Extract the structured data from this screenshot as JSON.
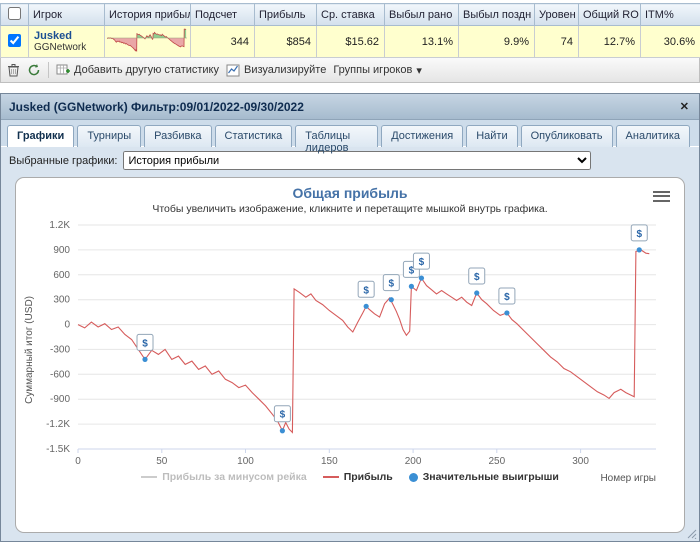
{
  "table": {
    "headers": [
      "Игрок",
      "История прибыли",
      "Подсчет",
      "Прибыль",
      "Ср. ставка",
      "Выбыл рано",
      "Выбыл поздн",
      "Уровен",
      "Общий RO",
      "ITM%"
    ],
    "row": {
      "selected": true,
      "player": "Jusked",
      "network": "GGNetwork",
      "count": "344",
      "profit": "$854",
      "avg_stake": "$15.62",
      "busted_early": "13.1%",
      "busted_late": "9.9%",
      "level": "74",
      "overall_ro": "12.7%",
      "itm": "30.6%"
    }
  },
  "toolbar": {
    "add_stat_label": "Добавить другую статистику",
    "visualize_label": "Визуализируйте",
    "player_groups_label": "Группы игроков",
    "dropdown_glyph": "▾"
  },
  "panel": {
    "title": "Jusked (GGNetwork) Фильтр:09/01/2022-09/30/2022",
    "close_glyph": "✕",
    "tabs": [
      "Графики",
      "Турниры",
      "Разбивка",
      "Статистика",
      "Таблицы лидеров",
      "Достижения",
      "Найти",
      "Опубликовать",
      "Аналитика"
    ],
    "active_tab": "Графики",
    "selected_charts_label": "Выбранные графики:",
    "selected_charts_value": "История прибыли"
  },
  "chart_data": {
    "type": "line",
    "title": "Общая прибыль",
    "subtitle": "Чтобы увеличить изображение, кликните и перетащите мышкой внутрь графика.",
    "xlabel": "Номер игры",
    "ylabel": "Суммарный итог (USD)",
    "xlim": [
      0,
      345
    ],
    "ylim": [
      -1500,
      1200
    ],
    "xticks": [
      0,
      50,
      100,
      150,
      200,
      250,
      300
    ],
    "yticks": [
      1200,
      900,
      600,
      300,
      0,
      -300,
      -600,
      -900,
      -1200,
      -1500
    ],
    "ytick_labels": [
      "1.2K",
      "900",
      "600",
      "300",
      "0",
      "-300",
      "-600",
      "-900",
      "-1.2K",
      "-1.5K"
    ],
    "grid": true,
    "legend_position": "bottom",
    "legend": [
      {
        "name": "Прибыль за минусом рейка",
        "color": "#cccccc",
        "type": "line",
        "enabled": false
      },
      {
        "name": "Прибыль",
        "color": "#d65c5c",
        "type": "line",
        "enabled": true
      },
      {
        "name": "Значительные выигрыши",
        "color": "#3b8fd4",
        "type": "marker",
        "enabled": true
      }
    ],
    "series": [
      {
        "name": "Прибыль",
        "color": "#d65c5c",
        "points": [
          [
            0,
            0
          ],
          [
            4,
            -40
          ],
          [
            8,
            30
          ],
          [
            12,
            -30
          ],
          [
            16,
            10
          ],
          [
            20,
            -60
          ],
          [
            24,
            -30
          ],
          [
            28,
            -120
          ],
          [
            32,
            -180
          ],
          [
            36,
            -300
          ],
          [
            40,
            -420
          ],
          [
            44,
            -310
          ],
          [
            48,
            -360
          ],
          [
            52,
            -300
          ],
          [
            56,
            -420
          ],
          [
            60,
            -380
          ],
          [
            64,
            -480
          ],
          [
            68,
            -440
          ],
          [
            72,
            -540
          ],
          [
            76,
            -500
          ],
          [
            80,
            -600
          ],
          [
            84,
            -560
          ],
          [
            88,
            -660
          ],
          [
            92,
            -700
          ],
          [
            96,
            -760
          ],
          [
            100,
            -730
          ],
          [
            104,
            -820
          ],
          [
            108,
            -900
          ],
          [
            112,
            -980
          ],
          [
            116,
            -1080
          ],
          [
            119,
            -1160
          ],
          [
            122,
            -1280
          ],
          [
            124,
            -1180
          ],
          [
            126,
            -1260
          ],
          [
            128,
            -1300
          ],
          [
            129,
            430
          ],
          [
            132,
            390
          ],
          [
            136,
            330
          ],
          [
            139,
            370
          ],
          [
            142,
            290
          ],
          [
            146,
            240
          ],
          [
            150,
            170
          ],
          [
            154,
            110
          ],
          [
            158,
            50
          ],
          [
            161,
            -30
          ],
          [
            164,
            -90
          ],
          [
            167,
            30
          ],
          [
            170,
            140
          ],
          [
            172,
            220
          ],
          [
            174,
            180
          ],
          [
            177,
            130
          ],
          [
            180,
            90
          ],
          [
            183,
            250
          ],
          [
            186,
            320
          ],
          [
            188,
            240
          ],
          [
            190,
            160
          ],
          [
            192,
            60
          ],
          [
            194,
            -60
          ],
          [
            196,
            -130
          ],
          [
            198,
            -80
          ],
          [
            199,
            460
          ],
          [
            202,
            410
          ],
          [
            205,
            560
          ],
          [
            208,
            470
          ],
          [
            211,
            420
          ],
          [
            214,
            370
          ],
          [
            217,
            410
          ],
          [
            220,
            370
          ],
          [
            223,
            330
          ],
          [
            226,
            290
          ],
          [
            229,
            330
          ],
          [
            232,
            270
          ],
          [
            235,
            230
          ],
          [
            238,
            380
          ],
          [
            241,
            300
          ],
          [
            244,
            250
          ],
          [
            248,
            170
          ],
          [
            252,
            110
          ],
          [
            256,
            140
          ],
          [
            259,
            60
          ],
          [
            262,
            10
          ],
          [
            266,
            -70
          ],
          [
            270,
            -150
          ],
          [
            274,
            -230
          ],
          [
            278,
            -310
          ],
          [
            282,
            -390
          ],
          [
            286,
            -450
          ],
          [
            290,
            -530
          ],
          [
            294,
            -570
          ],
          [
            298,
            -630
          ],
          [
            302,
            -690
          ],
          [
            306,
            -750
          ],
          [
            310,
            -810
          ],
          [
            314,
            -850
          ],
          [
            317,
            -890
          ],
          [
            320,
            -820
          ],
          [
            324,
            -780
          ],
          [
            327,
            -820
          ],
          [
            330,
            -850
          ],
          [
            332,
            -870
          ],
          [
            333,
            880
          ],
          [
            336,
            900
          ],
          [
            339,
            860
          ],
          [
            341,
            854
          ]
        ]
      }
    ],
    "markers": {
      "name": "Значительные выигрыши",
      "symbol": "$",
      "color": "#3b8fd4",
      "points": [
        [
          40,
          -420
        ],
        [
          122,
          -1280
        ],
        [
          172,
          220
        ],
        [
          187,
          300
        ],
        [
          199,
          460
        ],
        [
          205,
          560
        ],
        [
          238,
          380
        ],
        [
          256,
          140
        ],
        [
          335,
          900
        ]
      ]
    }
  }
}
